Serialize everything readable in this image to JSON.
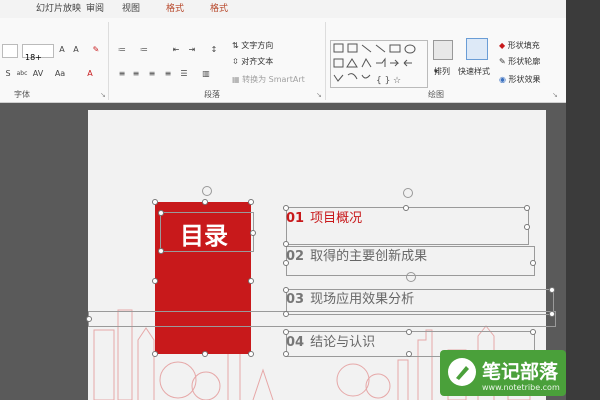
{
  "tabs": [
    {
      "label": "幻灯片放映"
    },
    {
      "label": "审阅"
    },
    {
      "label": "视图"
    },
    {
      "label": "格式"
    },
    {
      "label": "格式"
    }
  ],
  "ribbon": {
    "font_size": "18+",
    "font_group_label": "字体",
    "paragraph_group_label": "段落",
    "drawing_group_label": "绘图",
    "text_direction": "文字方向",
    "align_text": "对齐文本",
    "convert_smartart": "转换为 SmartArt",
    "arrange": "排列",
    "quick_styles": "快速样式",
    "shape_fill": "形状填充",
    "shape_outline": "形状轮廓",
    "shape_effects": "形状效果"
  },
  "slide": {
    "title": "目录",
    "items": [
      {
        "num": "01",
        "text": "项目概况"
      },
      {
        "num": "02",
        "text": "取得的主要创新成果"
      },
      {
        "num": "03",
        "text": "现场应用效果分析"
      },
      {
        "num": "04",
        "text": "结论与认识"
      }
    ]
  },
  "watermark": {
    "text": "笔记部落",
    "url": "www.notetribe.com"
  },
  "colors": {
    "accent_red": "#c8191b",
    "tab_accent": "#b7472a",
    "watermark_green": "#4aa03a"
  }
}
